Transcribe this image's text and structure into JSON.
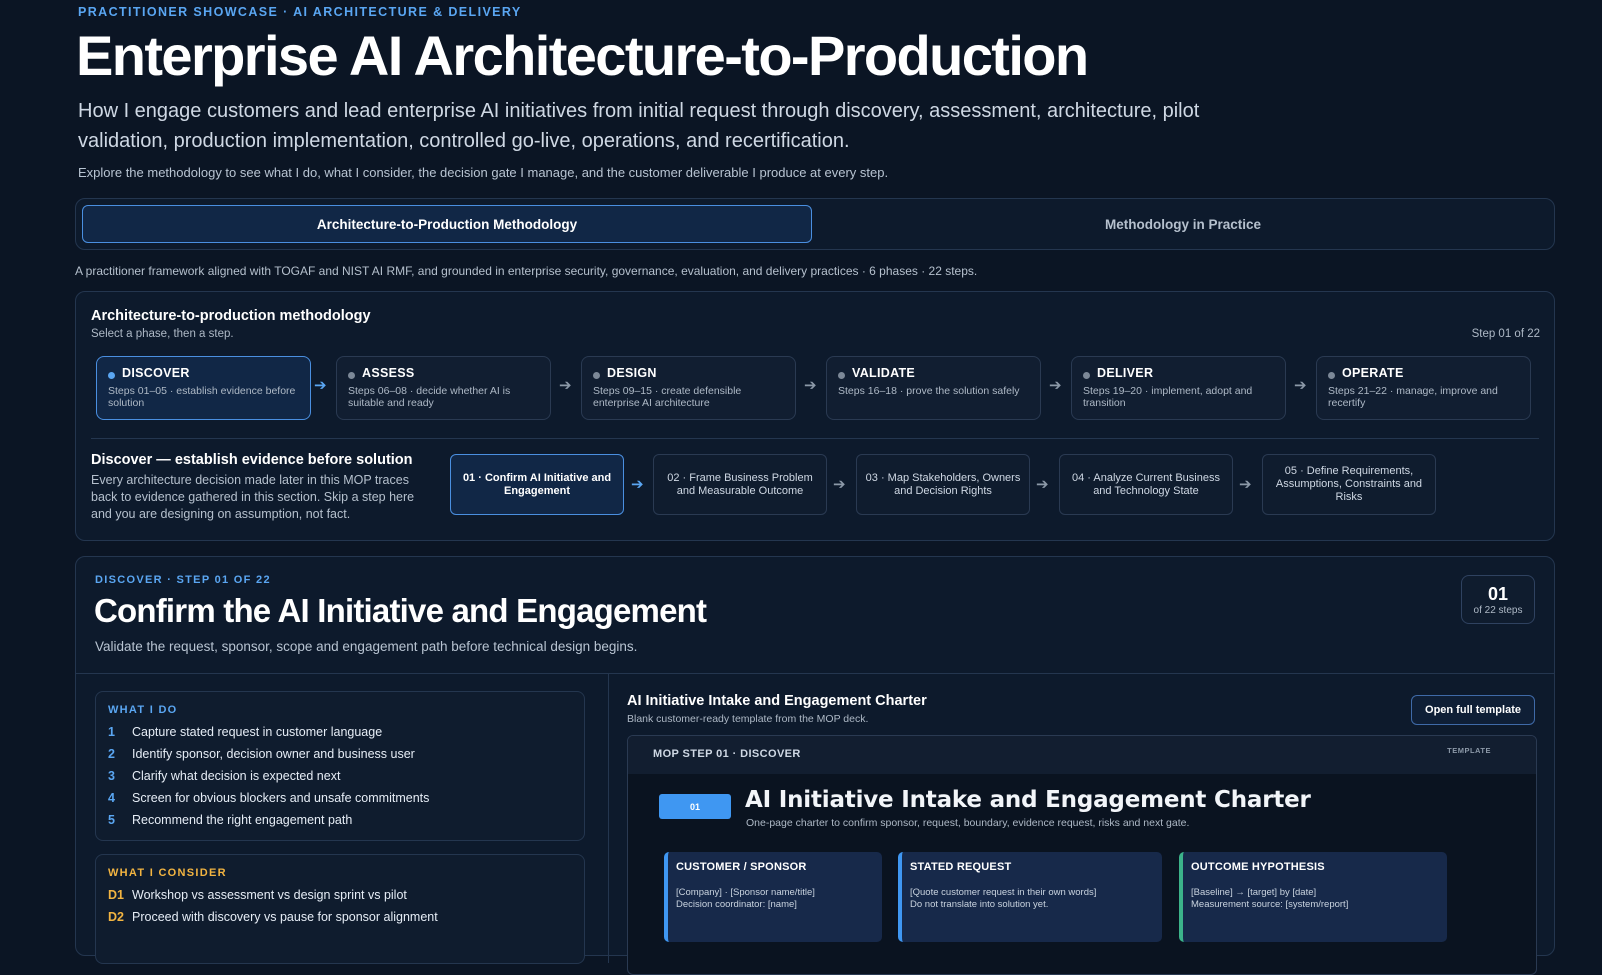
{
  "hero": {
    "eyebrow": "PRACTITIONER SHOWCASE · AI ARCHITECTURE & DELIVERY",
    "title": "Enterprise AI Architecture-to-Production",
    "subtitle": "How I engage customers and lead enterprise AI initiatives from initial request through discovery, assessment, architecture, pilot validation, production implementation, controlled go-live, operations, and recertification.",
    "note": "Explore the methodology to see what I do, what I consider, the decision gate I manage, and the customer deliverable I produce at every step."
  },
  "tabs": [
    {
      "label": "Architecture-to-Production Methodology",
      "active": true
    },
    {
      "label": "Methodology in Practice",
      "active": false
    }
  ],
  "framework_note": "A practitioner framework aligned with TOGAF and NIST AI RMF, and grounded in enterprise security, governance, evaluation, and delivery practices · 6 phases · 22 steps.",
  "methodology": {
    "title": "Architecture-to-production methodology",
    "subtitle": "Select a phase, then a step.",
    "counter": "Step 01 of 22",
    "phases": [
      {
        "name": "DISCOVER",
        "desc": "Steps 01–05 · establish evidence before solution",
        "active": true
      },
      {
        "name": "ASSESS",
        "desc": "Steps 06–08 · decide whether AI is suitable and ready",
        "active": false
      },
      {
        "name": "DESIGN",
        "desc": "Steps 09–15 · create defensible enterprise AI architecture",
        "active": false
      },
      {
        "name": "VALIDATE",
        "desc": "Steps 16–18 · prove the solution safely",
        "active": false
      },
      {
        "name": "DELIVER",
        "desc": "Steps 19–20 · implement, adopt and transition",
        "active": false
      },
      {
        "name": "OPERATE",
        "desc": "Steps 21–22 · manage, improve and recertify",
        "active": false
      }
    ],
    "phase_detail": {
      "title": "Discover — establish evidence before solution",
      "body": "Every architecture decision made later in this MOP traces back to evidence gathered in this section. Skip a step here and you are designing on assumption, not fact."
    },
    "steps": [
      {
        "label": "01 · Confirm AI Initiative and Engagement",
        "active": true
      },
      {
        "label": "02 · Frame Business Problem and Measurable Outcome",
        "active": false
      },
      {
        "label": "03 · Map Stakeholders, Owners and Decision Rights",
        "active": false
      },
      {
        "label": "04 · Analyze Current Business and Technology State",
        "active": false
      },
      {
        "label": "05 · Define Requirements, Assumptions, Constraints and Risks",
        "active": false
      }
    ]
  },
  "detail": {
    "eyebrow": "DISCOVER · STEP 01 OF 22",
    "title": "Confirm the AI Initiative and Engagement",
    "subtitle": "Validate the request, sponsor, scope and engagement path before technical design begins.",
    "counter_number": "01",
    "counter_of": "of 22 steps",
    "what_i_do": {
      "label": "WHAT I DO",
      "items": [
        {
          "num": "1",
          "text": "Capture stated request in customer language"
        },
        {
          "num": "2",
          "text": "Identify sponsor, decision owner and business user"
        },
        {
          "num": "3",
          "text": "Clarify what decision is expected next"
        },
        {
          "num": "4",
          "text": "Screen for obvious blockers and unsafe commitments"
        },
        {
          "num": "5",
          "text": "Recommend the right engagement path"
        }
      ]
    },
    "what_i_consider": {
      "label": "WHAT I CONSIDER",
      "items": [
        {
          "num": "D1",
          "text": "Workshop vs assessment vs design sprint vs pilot"
        },
        {
          "num": "D2",
          "text": "Proceed with discovery vs pause for sponsor alignment"
        }
      ]
    },
    "template": {
      "title": "AI Initiative Intake and Engagement Charter",
      "subtitle": "Blank customer-ready template from the MOP deck.",
      "open_label": "Open full template",
      "preview": {
        "header_label": "MOP STEP 01 · DISCOVER",
        "template_tag": "TEMPLATE",
        "badge": "01",
        "title": "AI Initiative Intake and Engagement Charter",
        "subtitle": "One-page charter to confirm sponsor, request, boundary, evidence request, risks and next gate.",
        "boxes": [
          {
            "label": "CUSTOMER / SPONSOR",
            "line1": "[Company] · [Sponsor name/title]",
            "line2": "Decision coordinator: [name]"
          },
          {
            "label": "STATED REQUEST",
            "line1": "[Quote customer request in their own words]",
            "line2": "Do not translate into solution yet."
          },
          {
            "label": "OUTCOME HYPOTHESIS",
            "line1": "[Baseline] → [target] by [date]",
            "line2": "Measurement source: [system/report]"
          }
        ]
      }
    }
  },
  "colors": {
    "background": "#0b1524",
    "accent": "#5aa6f2",
    "consider_accent": "#f2b441",
    "panel": "#0d1a2c",
    "border": "#24364f"
  }
}
